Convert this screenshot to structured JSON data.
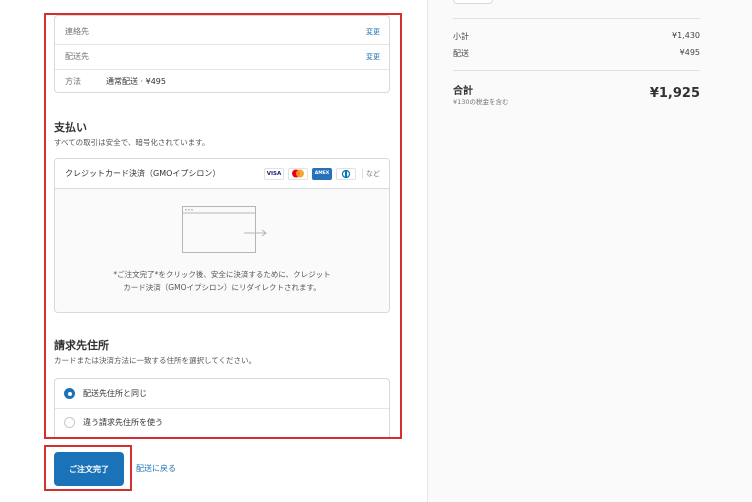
{
  "contact": {
    "rows": [
      {
        "label": "連絡先",
        "value": "",
        "action": "変更"
      },
      {
        "label": "配送先",
        "value": "",
        "action": "変更"
      },
      {
        "label": "方法",
        "value": "通常配送 · ¥495",
        "action": ""
      }
    ]
  },
  "payment": {
    "title": "支払い",
    "subtitle": "すべての取引は安全で、暗号化されています。",
    "method_name": "クレジットカード決済（GMOイプシロン）",
    "cards": [
      "VISA",
      "Mastercard",
      "AMEX",
      "Diners"
    ],
    "more_label": "など",
    "redirect_text_line1": "*ご注文完了*をクリック後、安全に決済するために、クレジット",
    "redirect_text_line2": "カード決済（GMOイプシロン）にリダイレクトされます。"
  },
  "billing": {
    "title": "請求先住所",
    "subtitle": "カードまたは決済方法に一致する住所を選択してください。",
    "options": [
      {
        "label": "配送先住所と同じ",
        "selected": true
      },
      {
        "label": "違う請求先住所を使う",
        "selected": false
      }
    ]
  },
  "actions": {
    "submit_label": "ご注文完了",
    "back_label": "配送に戻る"
  },
  "summary": {
    "subtotal_label": "小計",
    "subtotal_value": "¥1,430",
    "shipping_label": "配送",
    "shipping_value": "¥495",
    "total_label": "合計",
    "total_tax_note": "¥130の税金を含む",
    "total_value": "¥1,925"
  },
  "colors": {
    "accent": "#1a73b8",
    "highlight_border": "#d32f2f"
  }
}
